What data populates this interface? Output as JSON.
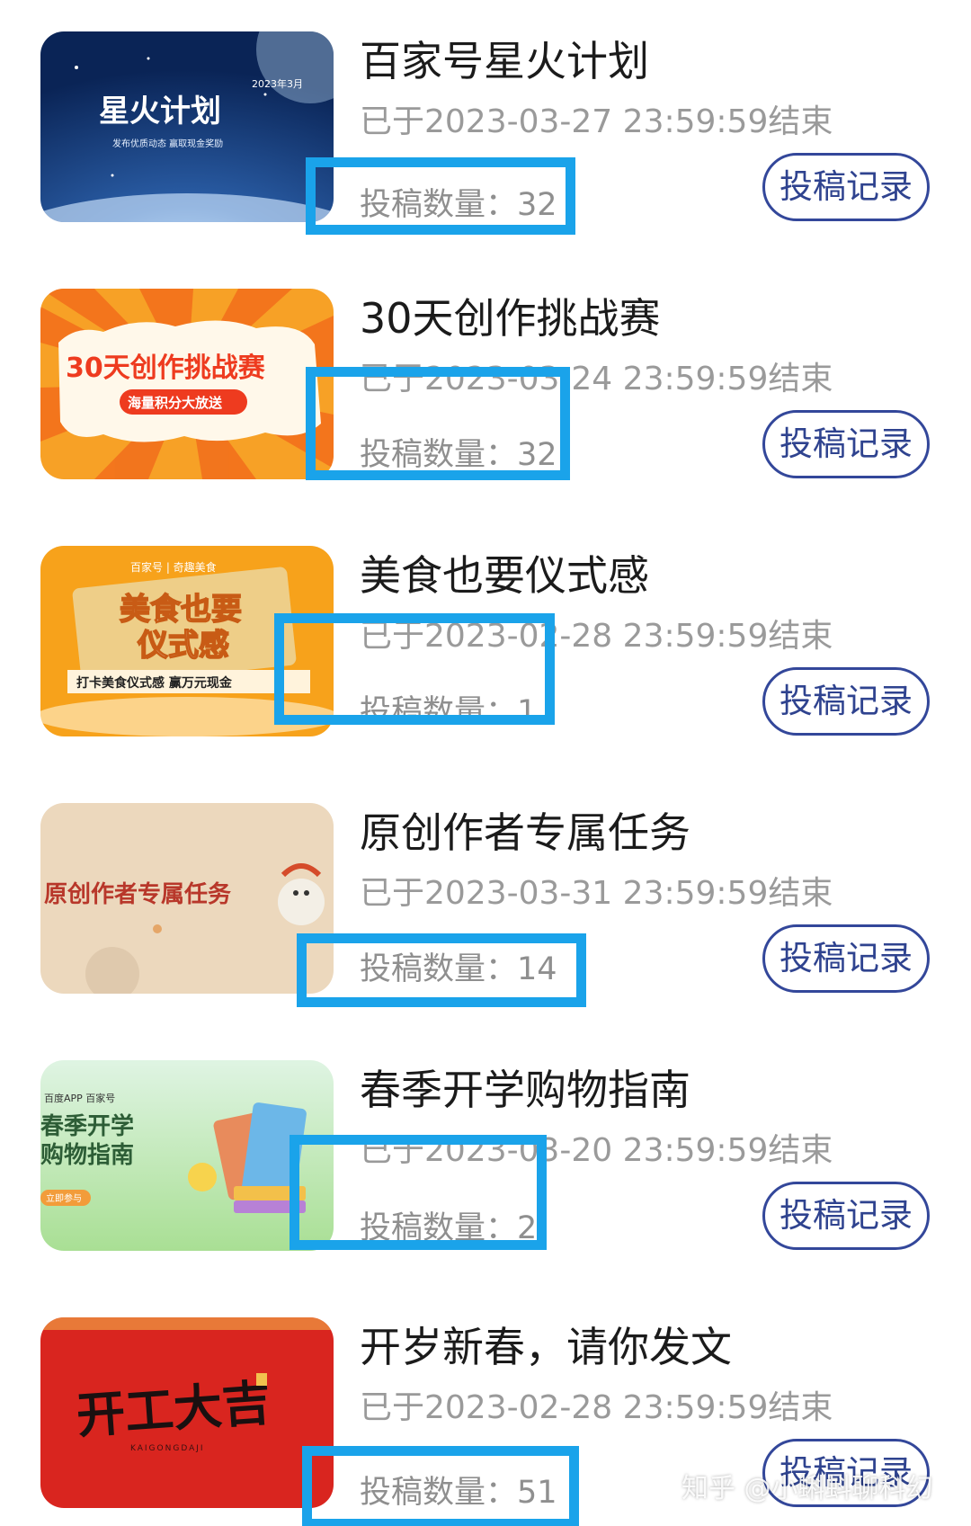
{
  "tasks": [
    {
      "title": "百家号星火计划",
      "ended": "已于2023-03-27 23:59:59结束",
      "count_label": "投稿数量：",
      "count": "32",
      "button": "投稿记录",
      "thumb": {
        "line1": "2023年3月",
        "line2": "星火计划",
        "line3": "发布优质动态 赢取现金奖励"
      }
    },
    {
      "title": "30天创作挑战赛",
      "ended": "已于2023-03-24 23:59:59结束",
      "count_label": "投稿数量：",
      "count": "32",
      "button": "投稿记录",
      "thumb": {
        "line1": "30天创作挑战赛",
        "line2": "海量积分大放送"
      }
    },
    {
      "title": "美食也要仪式感",
      "ended": "已于2023-02-28 23:59:59结束",
      "count_label": "投稿数量：",
      "count": "1",
      "button": "投稿记录",
      "thumb": {
        "line1": "百家号 | 奇趣美食",
        "line2": "美食也要",
        "line3": "仪式感",
        "line4": "打卡美食仪式感 赢万元现金"
      }
    },
    {
      "title": "原创作者专属任务",
      "ended": "已于2023-03-31 23:59:59结束",
      "count_label": "投稿数量：",
      "count": "14",
      "button": "投稿记录",
      "thumb": {
        "line1": "原创作者专属任务"
      }
    },
    {
      "title": "春季开学购物指南",
      "ended": "已于2023-03-20 23:59:59结束",
      "count_label": "投稿数量：",
      "count": "2",
      "button": "投稿记录",
      "thumb": {
        "line1": "百度APP  百家号",
        "line2": "春季开学",
        "line3": "购物指南",
        "line4": "立即参与"
      }
    },
    {
      "title": "开岁新春，请你发文",
      "ended": "已于2023-02-28 23:59:59结束",
      "count_label": "投稿数量：",
      "count": "51",
      "button": "投稿记录",
      "thumb": {
        "line1": "开工大吉",
        "line2": "KAIGONGDAJI"
      }
    }
  ],
  "watermark": "知乎 @小蝌蚪聊科幻",
  "colors": {
    "highlight": "#1aa3ea",
    "button_border": "#33479a",
    "button_text": "#2f438f"
  }
}
